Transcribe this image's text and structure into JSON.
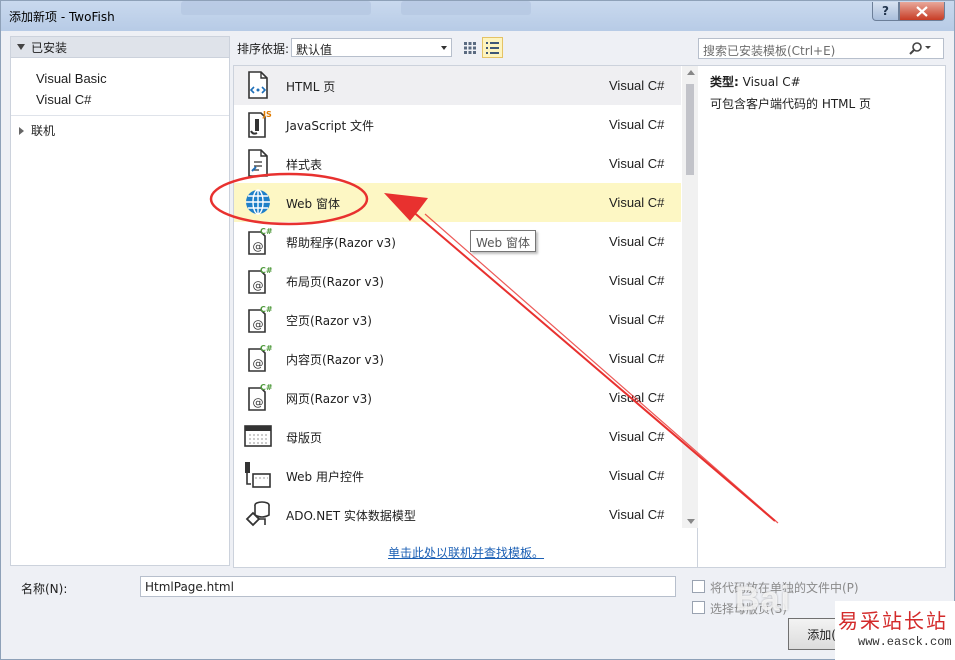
{
  "window": {
    "title": "添加新项 - TwoFish",
    "help_label": "?"
  },
  "sidebar": {
    "installed_label": "已安装",
    "languages": [
      {
        "label": "Visual Basic",
        "selected": false
      },
      {
        "label": "Visual C#",
        "selected": true
      }
    ],
    "online_label": "联机"
  },
  "toolbar": {
    "sort_label": "排序依据:",
    "sort_value": "默认值",
    "view_mode": "list",
    "search_placeholder": "搜索已安装模板(Ctrl+E)"
  },
  "templates": [
    {
      "name": "HTML 页",
      "lang": "Visual C#",
      "icon": "html-page-icon",
      "state": "hover"
    },
    {
      "name": "JavaScript 文件",
      "lang": "Visual C#",
      "icon": "javascript-file-icon",
      "state": ""
    },
    {
      "name": "样式表",
      "lang": "Visual C#",
      "icon": "stylesheet-icon",
      "state": ""
    },
    {
      "name": "Web 窗体",
      "lang": "Visual C#",
      "icon": "globe-icon",
      "state": "selected"
    },
    {
      "name": "帮助程序(Razor v3)",
      "lang": "Visual C#",
      "icon": "razor-page-icon",
      "state": ""
    },
    {
      "name": "布局页(Razor v3)",
      "lang": "Visual C#",
      "icon": "razor-page-icon",
      "state": ""
    },
    {
      "name": "空页(Razor v3)",
      "lang": "Visual C#",
      "icon": "razor-page-icon",
      "state": ""
    },
    {
      "name": "内容页(Razor v3)",
      "lang": "Visual C#",
      "icon": "razor-page-icon",
      "state": ""
    },
    {
      "name": "网页(Razor v3)",
      "lang": "Visual C#",
      "icon": "razor-page-icon",
      "state": ""
    },
    {
      "name": "母版页",
      "lang": "Visual C#",
      "icon": "master-page-icon",
      "state": ""
    },
    {
      "name": "Web 用户控件",
      "lang": "Visual C#",
      "icon": "user-control-icon",
      "state": ""
    },
    {
      "name": "ADO.NET 实体数据模型",
      "lang": "Visual C#",
      "icon": "entity-model-icon",
      "state": ""
    }
  ],
  "online_link": "单击此处以联机并查找模板。",
  "tooltip": "Web 窗体",
  "details": {
    "type_label": "类型:",
    "type_value": "Visual C#",
    "description": "可包含客户端代码的 HTML 页"
  },
  "bottom": {
    "name_label": "名称(N):",
    "name_value": "HtmlPage.html",
    "option1_label": "将代码放在单独的文件中(P)",
    "option2_label": "选择母版页(S)",
    "add_button": "添加(A)"
  },
  "watermarks": {
    "baidu": "Bai",
    "site_name": "易采站长站",
    "site_url": "www.easck.com"
  },
  "colors": {
    "selection": "#3399ff",
    "selected_row": "#fdf7c4",
    "annotation": "#e8312f",
    "link": "#1b5fb4"
  }
}
